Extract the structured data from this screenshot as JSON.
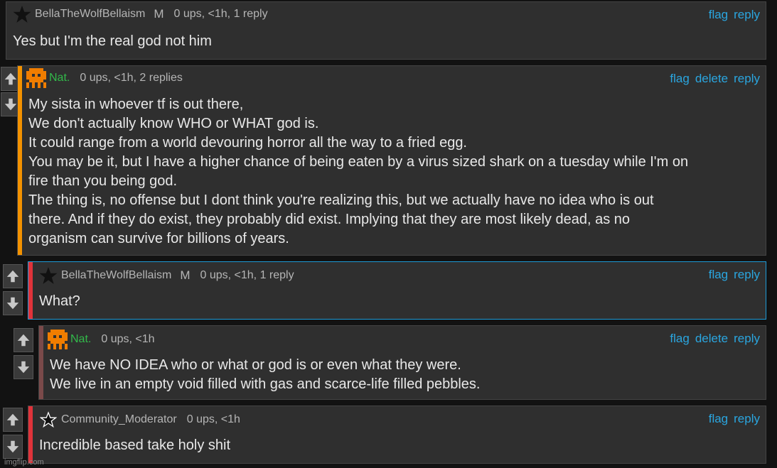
{
  "comments": [
    {
      "username": "BellaTheWolfBellaism",
      "badge": "M",
      "meta": "0 ups, <1h, 1 reply",
      "actions": [
        "flag",
        "reply"
      ],
      "text": [
        "Yes but I'm the real god not him"
      ]
    },
    {
      "username": "Nat.",
      "meta": "0 ups, <1h, 2 replies",
      "actions": [
        "flag",
        "delete",
        "reply"
      ],
      "text": [
        "My sista in whoever tf is out there,",
        "We don't actually know WHO or WHAT god is.",
        "It could range from a world devouring horror all the way to a fried egg.",
        "You may be it, but I have a higher chance of being eaten by a virus sized shark on a tuesday while I'm on",
        "fire than you being god.",
        "The thing is, no offense but I dont think you're realizing this, but we actually have no idea who is out",
        "there. And if they do exist, they probably did exist. Implying that they are most likely dead, as no",
        "organism can survive for billions of years."
      ]
    },
    {
      "username": "BellaTheWolfBellaism",
      "badge": "M",
      "meta": "0 ups, <1h, 1 reply",
      "actions": [
        "flag",
        "reply"
      ],
      "text": [
        "What?"
      ]
    },
    {
      "username": "Nat.",
      "meta": "0 ups, <1h",
      "actions": [
        "flag",
        "delete",
        "reply"
      ],
      "text": [
        "We have NO IDEA who or what or god is or even what they were.",
        "We live in an empty void filled with gas and scarce-life filled pebbles."
      ]
    },
    {
      "username": "Community_Moderator",
      "meta": "0 ups, <1h",
      "actions": [
        "flag",
        "reply"
      ],
      "text": [
        "Incredible based take holy shit"
      ]
    }
  ],
  "watermark": "imgflip.com",
  "colors": {
    "thread_orange": "#f39200",
    "thread_red": "#e0333a",
    "thread_brown": "#7a4a4a",
    "link_blue": "#2aa6e0",
    "username_green": "#32b94a",
    "highlight_border": "#1e9bd7"
  }
}
